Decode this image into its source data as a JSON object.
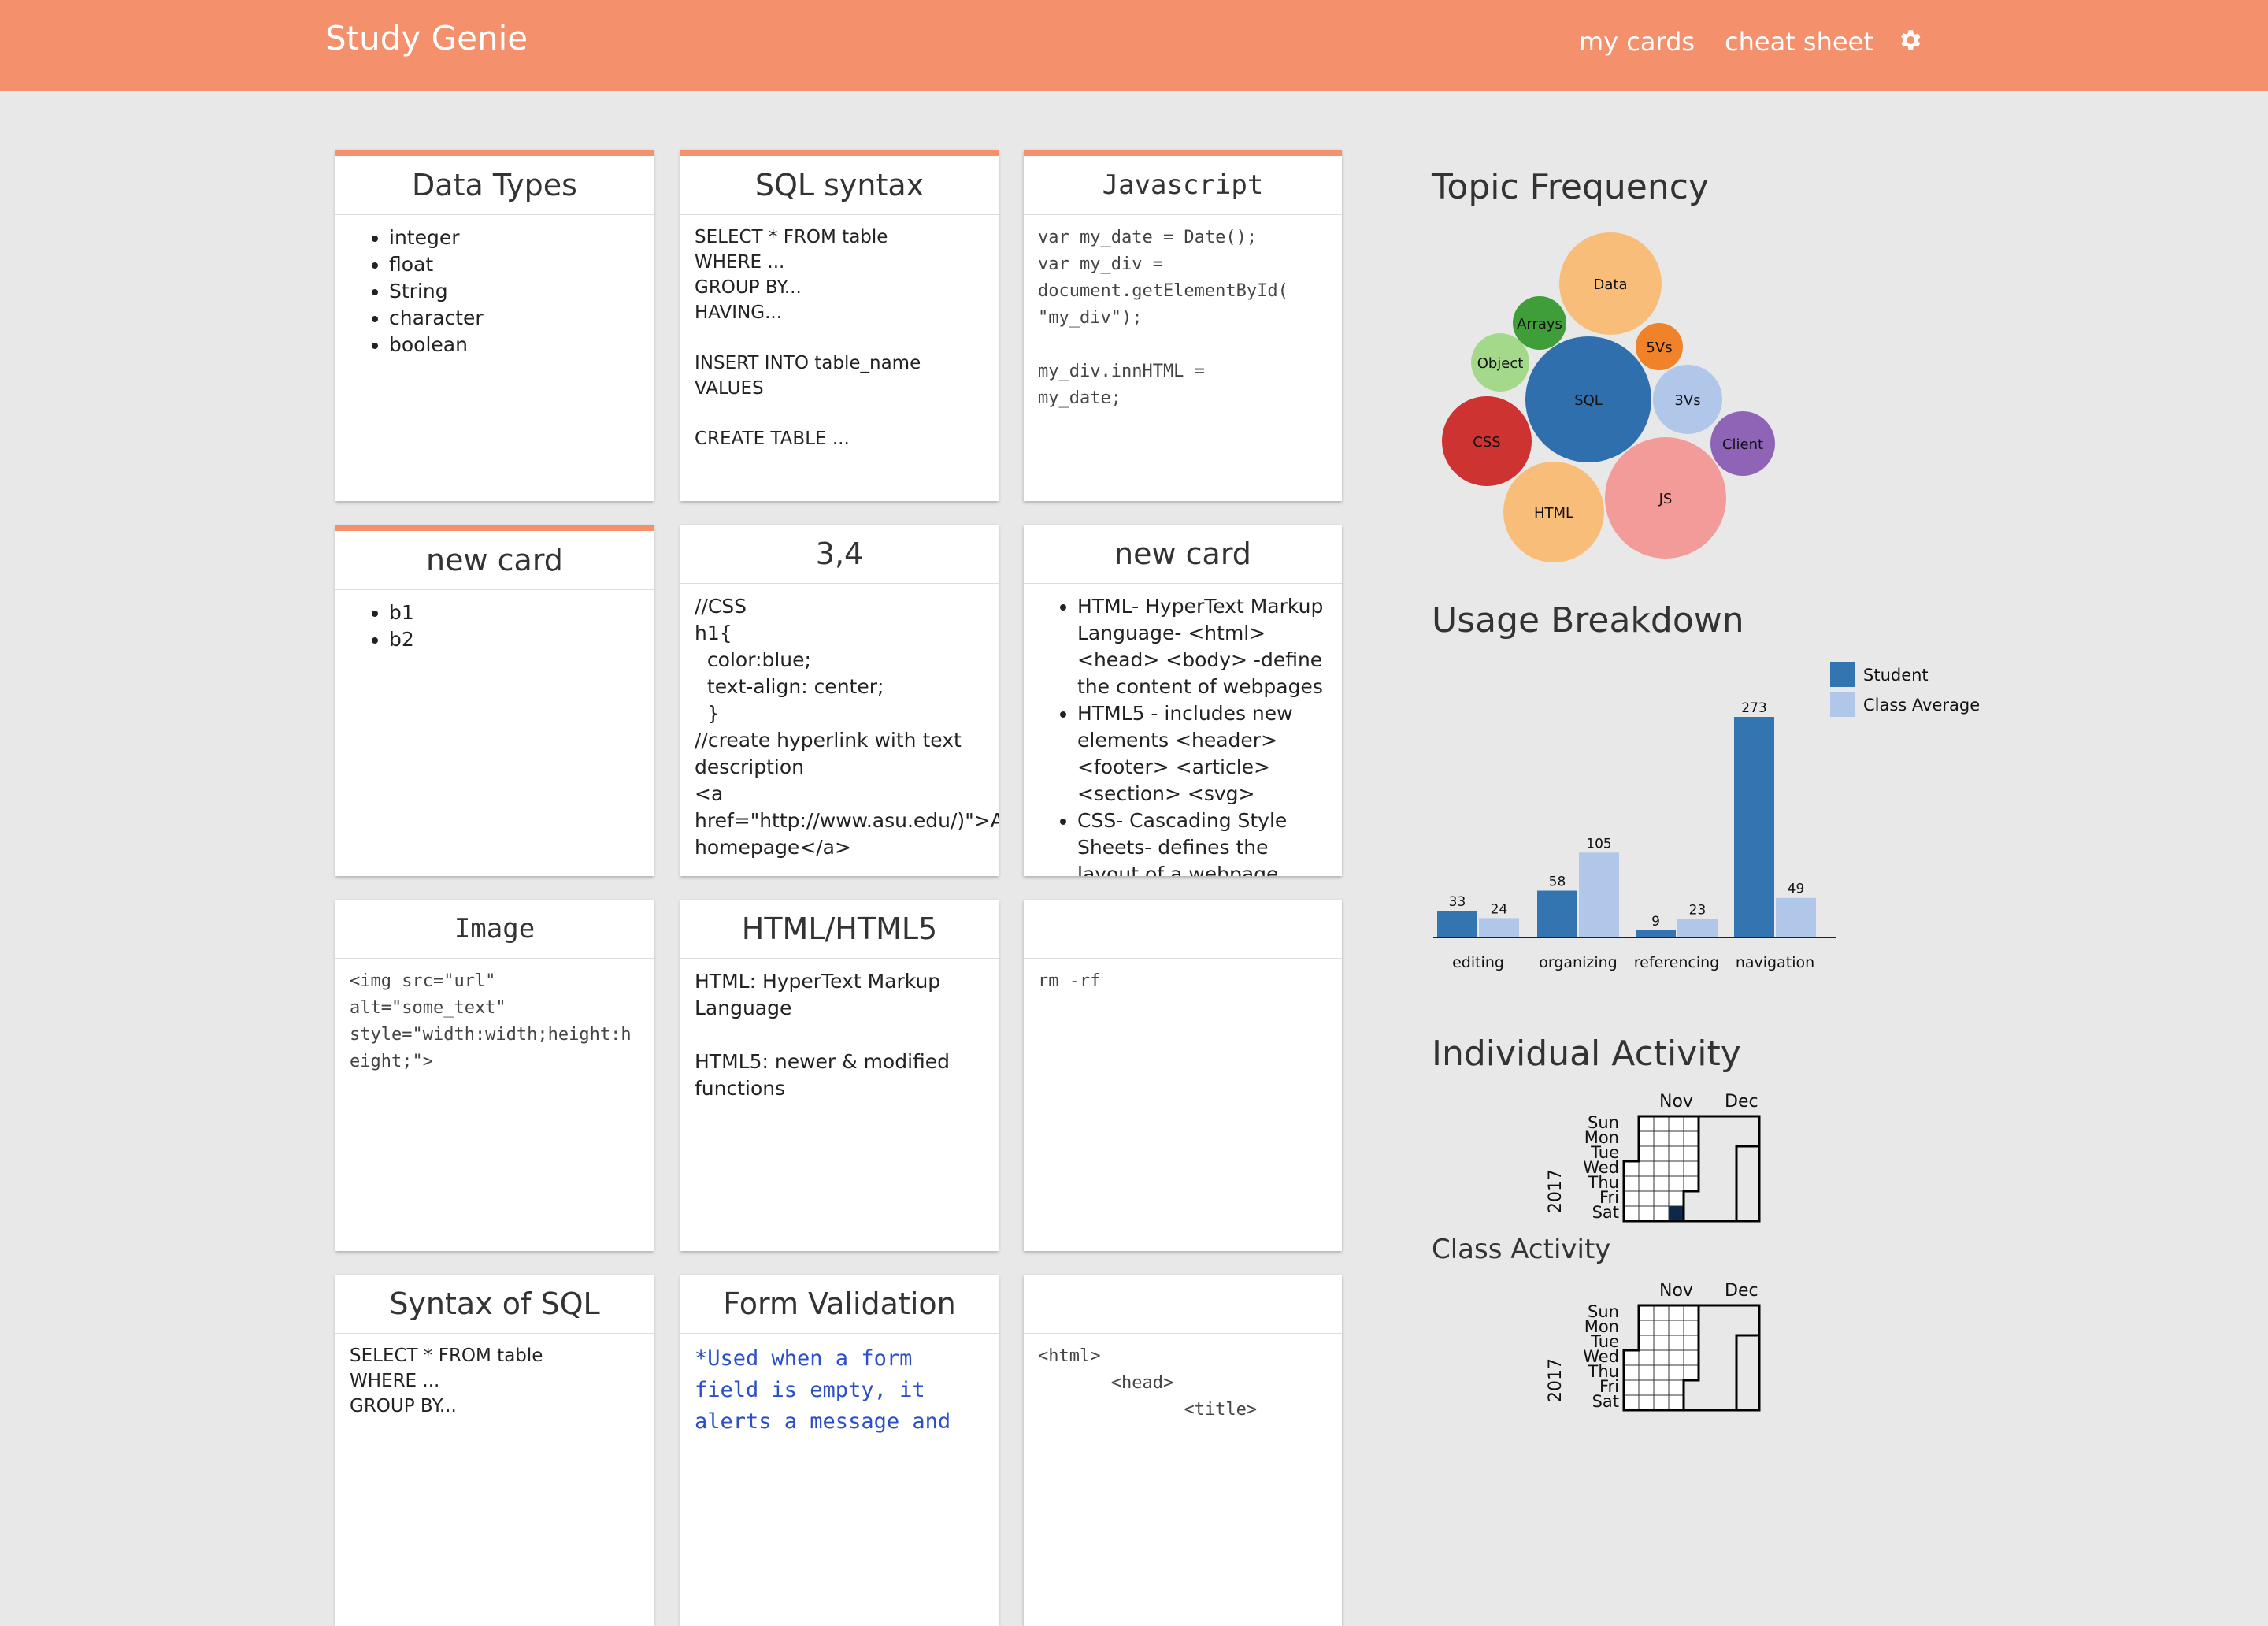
{
  "nav": {
    "brand": "Study Genie",
    "links": [
      "my cards",
      "cheat sheet"
    ],
    "settings_icon": "gear-icon"
  },
  "cards": [
    {
      "title": "Data Types",
      "type": "list",
      "items": [
        "integer",
        "float",
        "String",
        "character",
        "boolean"
      ]
    },
    {
      "title": "SQL syntax",
      "type": "text",
      "body": "SELECT * FROM table\nWHERE ...\nGROUP BY...\nHAVING...\n\nINSERT INTO table_name\nVALUES\n\nCREATE TABLE ..."
    },
    {
      "title": "Javascript",
      "type": "code",
      "body": "var my_date = Date();\nvar my_div =\ndocument.getElementById(\n\"my_div\");\n\nmy_div.innHTML =\nmy_date;"
    },
    {
      "title": "new card",
      "type": "list",
      "items": [
        "b1",
        "b2"
      ]
    },
    {
      "title": "3,4",
      "type": "text2",
      "body": "//CSS\nh1{\n  color:blue;\n  text-align: center;\n  }\n//create hyperlink with text description\n<a href=\"http://www.asu.edu/)\">ASU homepage</a>"
    },
    {
      "title": "new card",
      "type": "list",
      "items": [
        "HTML- HyperText Markup Language- <html> <head> <body> -define the content of webpages",
        "HTML5 - includes new elements <header> <footer> <article> <section> <svg>",
        "CSS- Cascading Style Sheets- defines the layout of a webpage"
      ]
    },
    {
      "title": "Image",
      "type": "code",
      "body": "<img src=\"url\"\nalt=\"some_text\"\nstyle=\"width:width;height:height;\">"
    },
    {
      "title": "HTML/HTML5",
      "type": "text2",
      "body": "HTML: HyperText Markup Language\n\nHTML5: newer & modified functions"
    },
    {
      "title": "",
      "type": "code",
      "body": "rm -rf"
    },
    {
      "title": "Syntax of SQL",
      "type": "text",
      "body": "SELECT * FROM table\nWHERE ...\nGROUP BY..."
    },
    {
      "title": "Form Validation",
      "type": "codeblue",
      "body": "*Used when a form\nfield is empty, it\nalerts a message and"
    },
    {
      "title": "",
      "type": "code",
      "body": "<html>\n       <head>\n              <title>"
    }
  ],
  "topic_frequency": {
    "title": "Topic Frequency",
    "bubbles": [
      {
        "label": "Data",
        "color": "#f7bd79"
      },
      {
        "label": "Arrays",
        "color": "#3f9e3a"
      },
      {
        "label": "5Vs",
        "color": "#f0832a"
      },
      {
        "label": "Object",
        "color": "#a4d88a"
      },
      {
        "label": "SQL",
        "color": "#2f6fae"
      },
      {
        "label": "3Vs",
        "color": "#b1c7e9"
      },
      {
        "label": "CSS",
        "color": "#cc3331"
      },
      {
        "label": "Client",
        "color": "#8f64b7"
      },
      {
        "label": "HTML",
        "color": "#f7bd79"
      },
      {
        "label": "JS",
        "color": "#f29b98"
      }
    ]
  },
  "usage_breakdown": {
    "title": "Usage Breakdown",
    "chart_data": {
      "type": "bar",
      "categories": [
        "editing",
        "organizing",
        "referencing",
        "navigation"
      ],
      "series": [
        {
          "name": "Student",
          "values": [
            33,
            58,
            9,
            273
          ],
          "color": "#3474b0"
        },
        {
          "name": "Class Average",
          "values": [
            24,
            105,
            23,
            49
          ],
          "color": "#b1c7e9"
        }
      ],
      "ylim": [
        0,
        273
      ],
      "legend": "top-right"
    }
  },
  "individual_activity": {
    "title": "Individual Activity",
    "year": "2017",
    "months": [
      "Nov",
      "Dec"
    ],
    "days": [
      "Sun",
      "Mon",
      "Tue",
      "Wed",
      "Thu",
      "Fri",
      "Sat"
    ]
  },
  "class_activity": {
    "title": "Class Activity",
    "year": "2017",
    "months": [
      "Nov",
      "Dec"
    ],
    "days": [
      "Sun",
      "Mon",
      "Tue",
      "Wed",
      "Thu",
      "Fri",
      "Sat"
    ]
  }
}
